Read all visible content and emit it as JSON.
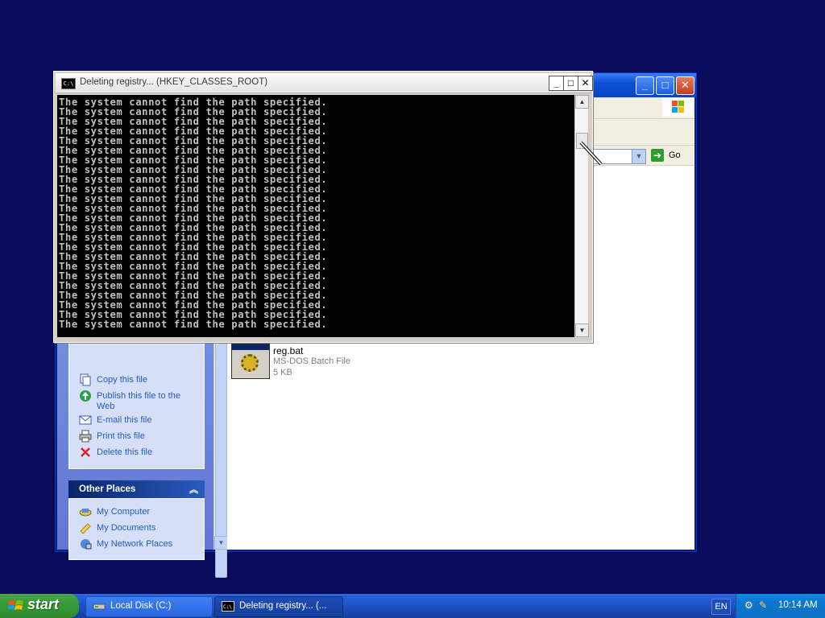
{
  "console": {
    "title": "Deleting registry... (HKEY_CLASSES_ROOT)",
    "lines": [
      "The system cannot find the path specified.",
      "The system cannot find the path specified.",
      "The system cannot find the path specified.",
      "The system cannot find the path specified.",
      "The system cannot find the path specified.",
      "The system cannot find the path specified.",
      "The system cannot find the path specified.",
      "The system cannot find the path specified.",
      "The system cannot find the path specified.",
      "The system cannot find the path specified.",
      "The system cannot find the path specified.",
      "The system cannot find the path specified.",
      "The system cannot find the path specified.",
      "The system cannot find the path specified.",
      "The system cannot find the path specified.",
      "The system cannot find the path specified.",
      "The system cannot find the path specified.",
      "The system cannot find the path specified.",
      "The system cannot find the path specified.",
      "The system cannot find the path specified.",
      "The system cannot find the path specified.",
      "The system cannot find the path specified.",
      "The system cannot find the path specified.",
      "The system cannot find the path specified."
    ],
    "minimize_label": "_",
    "maximize_label": "□",
    "close_label": "✕",
    "icon_label": "C:\\"
  },
  "explorer": {
    "go_label": "Go",
    "file_tasks": [
      {
        "label": "Copy this file",
        "icon": "copy-icon"
      },
      {
        "label": "Publish this file to the Web",
        "icon": "globe-icon"
      },
      {
        "label": "E-mail this file",
        "icon": "email-icon"
      },
      {
        "label": "Print this file",
        "icon": "printer-icon"
      },
      {
        "label": "Delete this file",
        "icon": "delete-icon"
      }
    ],
    "other_places": {
      "header": "Other Places",
      "items": [
        {
          "label": "My Computer",
          "icon": "computer-icon"
        },
        {
          "label": "My Documents",
          "icon": "folder-icon"
        },
        {
          "label": "My Network Places",
          "icon": "network-icon"
        }
      ]
    },
    "file": {
      "name": "reg.bat",
      "type": "MS-DOS Batch File",
      "size": "5 KB"
    }
  },
  "taskbar": {
    "start_label": "start",
    "items": [
      {
        "label": "Local Disk (C:)",
        "icon": "drive-icon",
        "active": false
      },
      {
        "label": "Deleting registry... (...",
        "icon": "console-icon",
        "active": true
      }
    ],
    "language": "EN",
    "clock": "10:14 AM"
  },
  "colors": {
    "desktop": "#0a0a5a",
    "xp_blue": "#0b50d8",
    "start_green": "#379b37",
    "console_text": "#c0c0c0"
  }
}
